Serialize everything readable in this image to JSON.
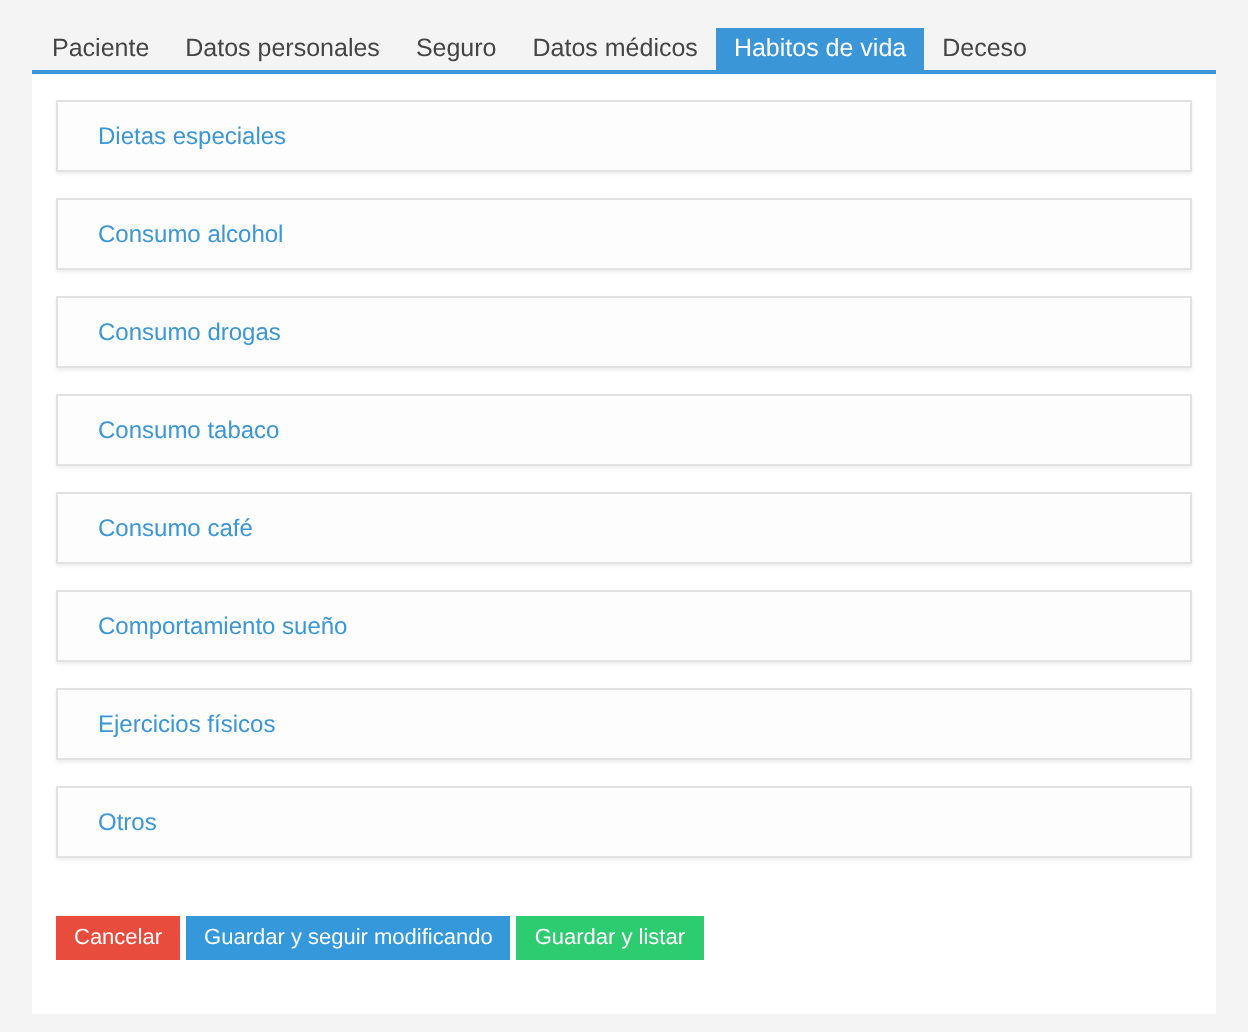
{
  "tabs": [
    {
      "label": "Paciente",
      "selected": false
    },
    {
      "label": "Datos personales",
      "selected": false
    },
    {
      "label": "Seguro",
      "selected": false
    },
    {
      "label": "Datos médicos",
      "selected": false
    },
    {
      "label": "Habitos de vida",
      "selected": true
    },
    {
      "label": "Deceso",
      "selected": false
    }
  ],
  "sections": [
    "Dietas especiales",
    "Consumo alcohol",
    "Consumo drogas",
    "Consumo tabaco",
    "Consumo café",
    "Comportamiento sueño",
    "Ejercicios físicos",
    "Otros"
  ],
  "buttons": [
    {
      "label": "Cancelar",
      "kind": "danger"
    },
    {
      "label": "Guardar y seguir modificando",
      "kind": "primary"
    },
    {
      "label": "Guardar y listar",
      "kind": "success"
    }
  ]
}
